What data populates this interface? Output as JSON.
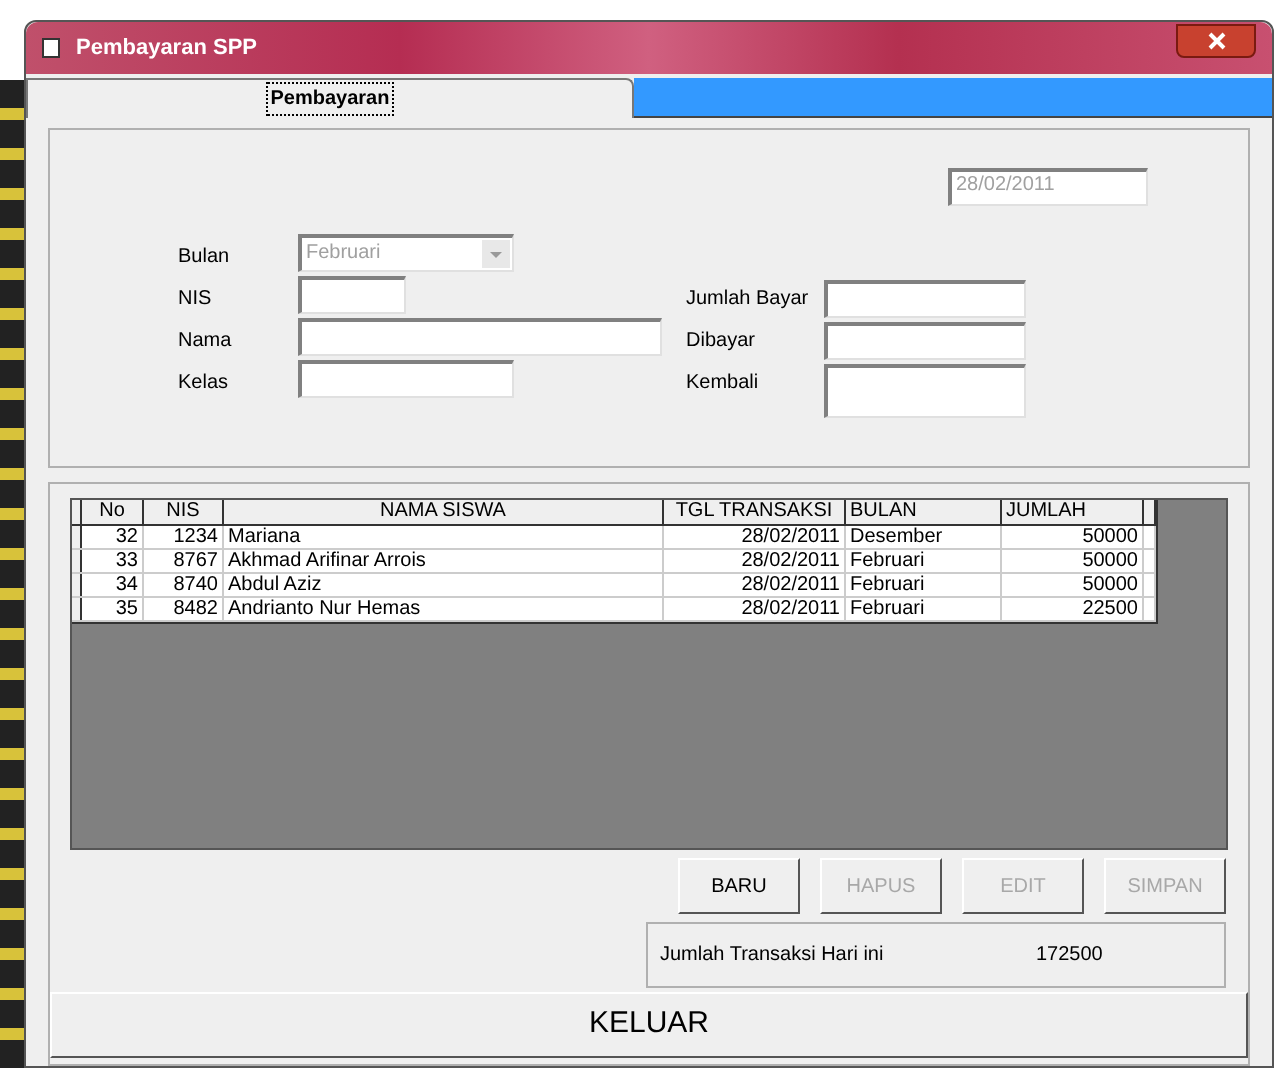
{
  "window": {
    "title": "Pembayaran SPP"
  },
  "tabs": [
    {
      "label": "Pembayaran",
      "selected": true
    }
  ],
  "date_field": {
    "value": "28/02/2011",
    "disabled": true
  },
  "form_left": [
    {
      "label": "Bulan",
      "kind": "dropdown",
      "value": "Februari",
      "disabled": true
    },
    {
      "label": "NIS",
      "kind": "text"
    },
    {
      "label": "Nama",
      "kind": "text"
    },
    {
      "label": "Kelas",
      "kind": "text"
    }
  ],
  "form_right": [
    {
      "label": "Jumlah Bayar",
      "kind": "text"
    },
    {
      "label": "Dibayar",
      "kind": "text"
    },
    {
      "label": "Kembali",
      "kind": "multiline"
    }
  ],
  "table": {
    "columns": [
      "No",
      "NIS",
      "NAMA SISWA",
      "TGL TRANSAKSI",
      "BULAN",
      "JUMLAH"
    ],
    "rows": [
      [
        "32",
        "1234",
        "Mariana",
        "28/02/2011",
        "Desember",
        "50000"
      ],
      [
        "33",
        "8767",
        "Akhmad Arifinar Arrois",
        "28/02/2011",
        "Februari",
        "50000"
      ],
      [
        "34",
        "8740",
        "Abdul Aziz",
        "28/02/2011",
        "Februari",
        "50000"
      ],
      [
        "35",
        "8482",
        "Andrianto Nur Hemas",
        "28/02/2011",
        "Februari",
        "22500"
      ]
    ]
  },
  "buttons": [
    {
      "label": "BARU",
      "disabled": false
    },
    {
      "label": "HAPUS",
      "disabled": true
    },
    {
      "label": "EDIT",
      "disabled": true
    },
    {
      "label": "SIMPAN",
      "disabled": true
    }
  ],
  "summary": {
    "label": "Jumlah Transaksi Hari ini",
    "value": "172500"
  },
  "exit_button": {
    "label": "KELUAR"
  }
}
